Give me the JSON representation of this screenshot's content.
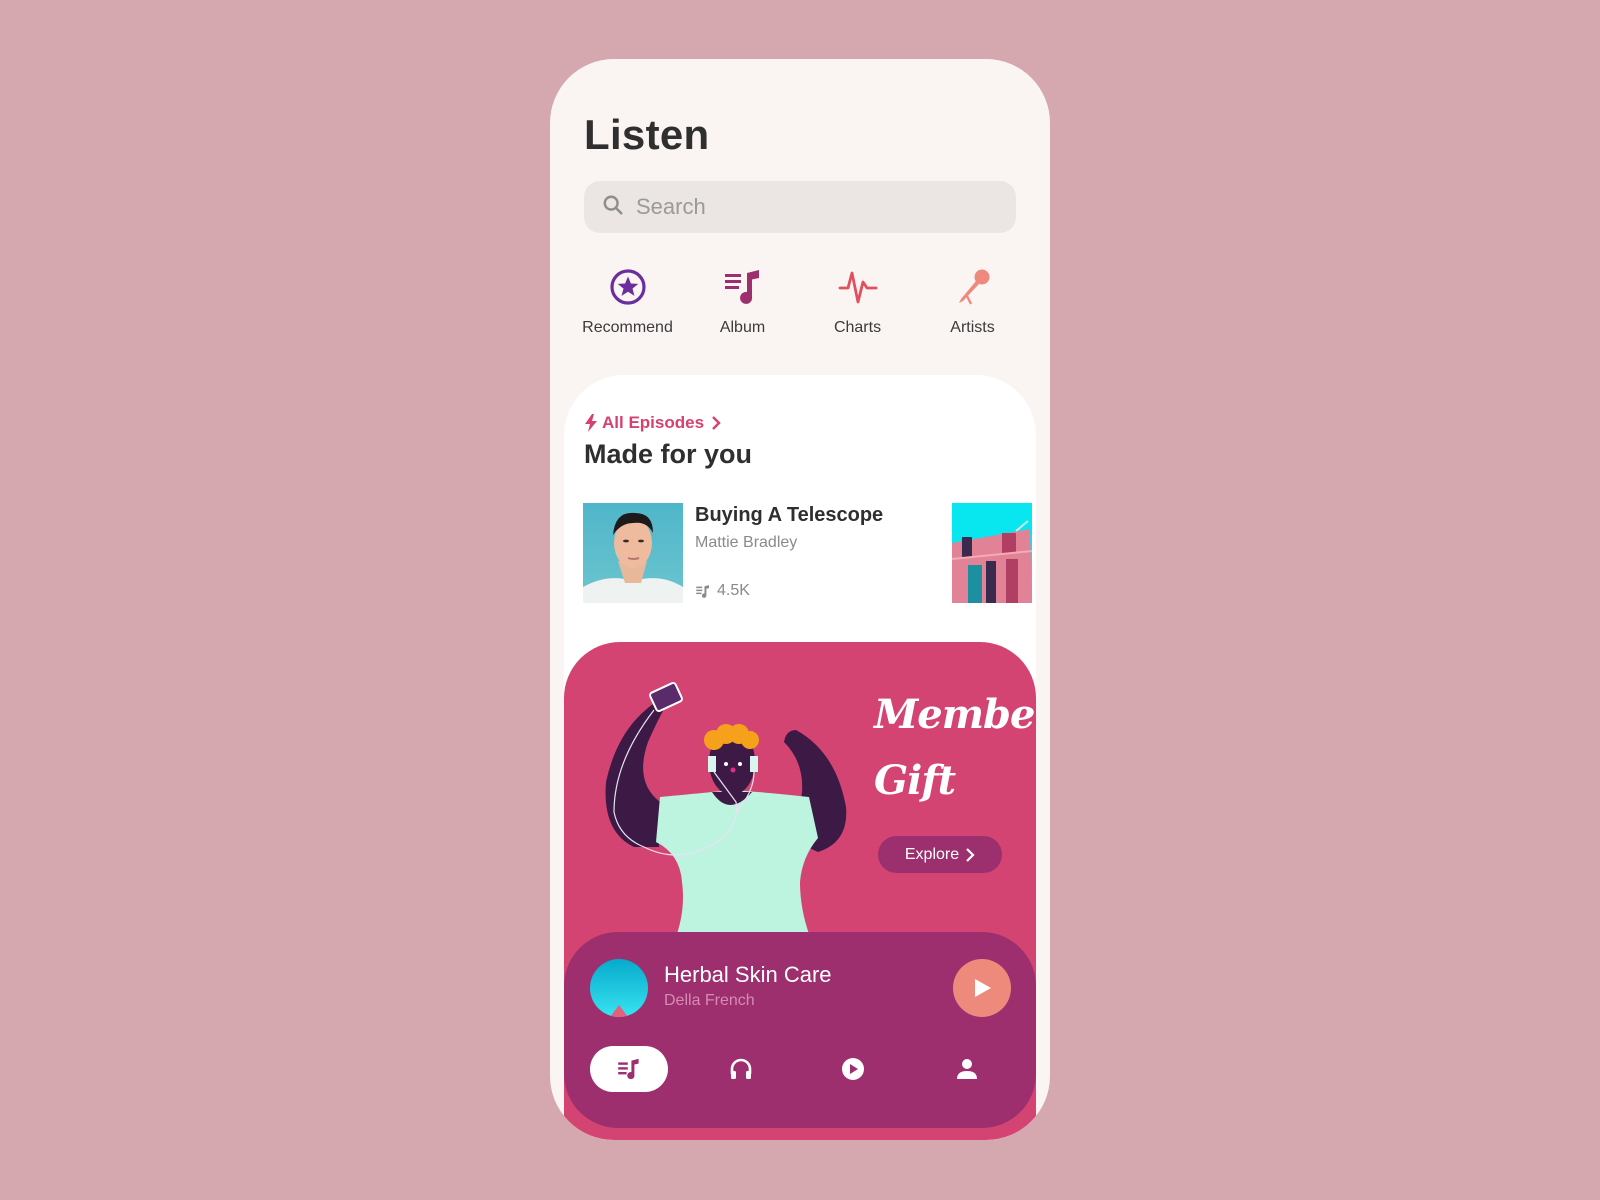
{
  "header": {
    "title": "Listen"
  },
  "search": {
    "placeholder": "Search",
    "value": ""
  },
  "categories": [
    {
      "label": "Recommend",
      "icon": "star-circle-icon",
      "color": "#6b2e9e"
    },
    {
      "label": "Album",
      "icon": "music-list-icon",
      "color": "#9d2f6e"
    },
    {
      "label": "Charts",
      "icon": "pulse-icon",
      "color": "#e0505f"
    },
    {
      "label": "Artists",
      "icon": "microphone-icon",
      "color": "#ee8a7c"
    }
  ],
  "made_for_you": {
    "link_label": "All Episodes",
    "title": "Made for you",
    "episodes": [
      {
        "title": "Buying A Telescope",
        "author": "Mattie Bradley",
        "plays": "4.5K"
      }
    ]
  },
  "banner": {
    "line1": "Member",
    "line2": "Gift",
    "button_label": "Explore"
  },
  "now_playing": {
    "title": "Herbal Skin Care",
    "author": "Della French"
  },
  "bottom_nav": [
    {
      "name": "library",
      "icon": "music-list-icon",
      "active": true
    },
    {
      "name": "podcasts",
      "icon": "headphones-icon",
      "active": false
    },
    {
      "name": "play",
      "icon": "play-circle-icon",
      "active": false
    },
    {
      "name": "profile",
      "icon": "user-icon",
      "active": false
    }
  ],
  "colors": {
    "accent": "#d6416f",
    "banner": "#d44473",
    "player": "#9d2f6e",
    "play_button": "#ee8a7c",
    "background": "#d5a8b0"
  }
}
